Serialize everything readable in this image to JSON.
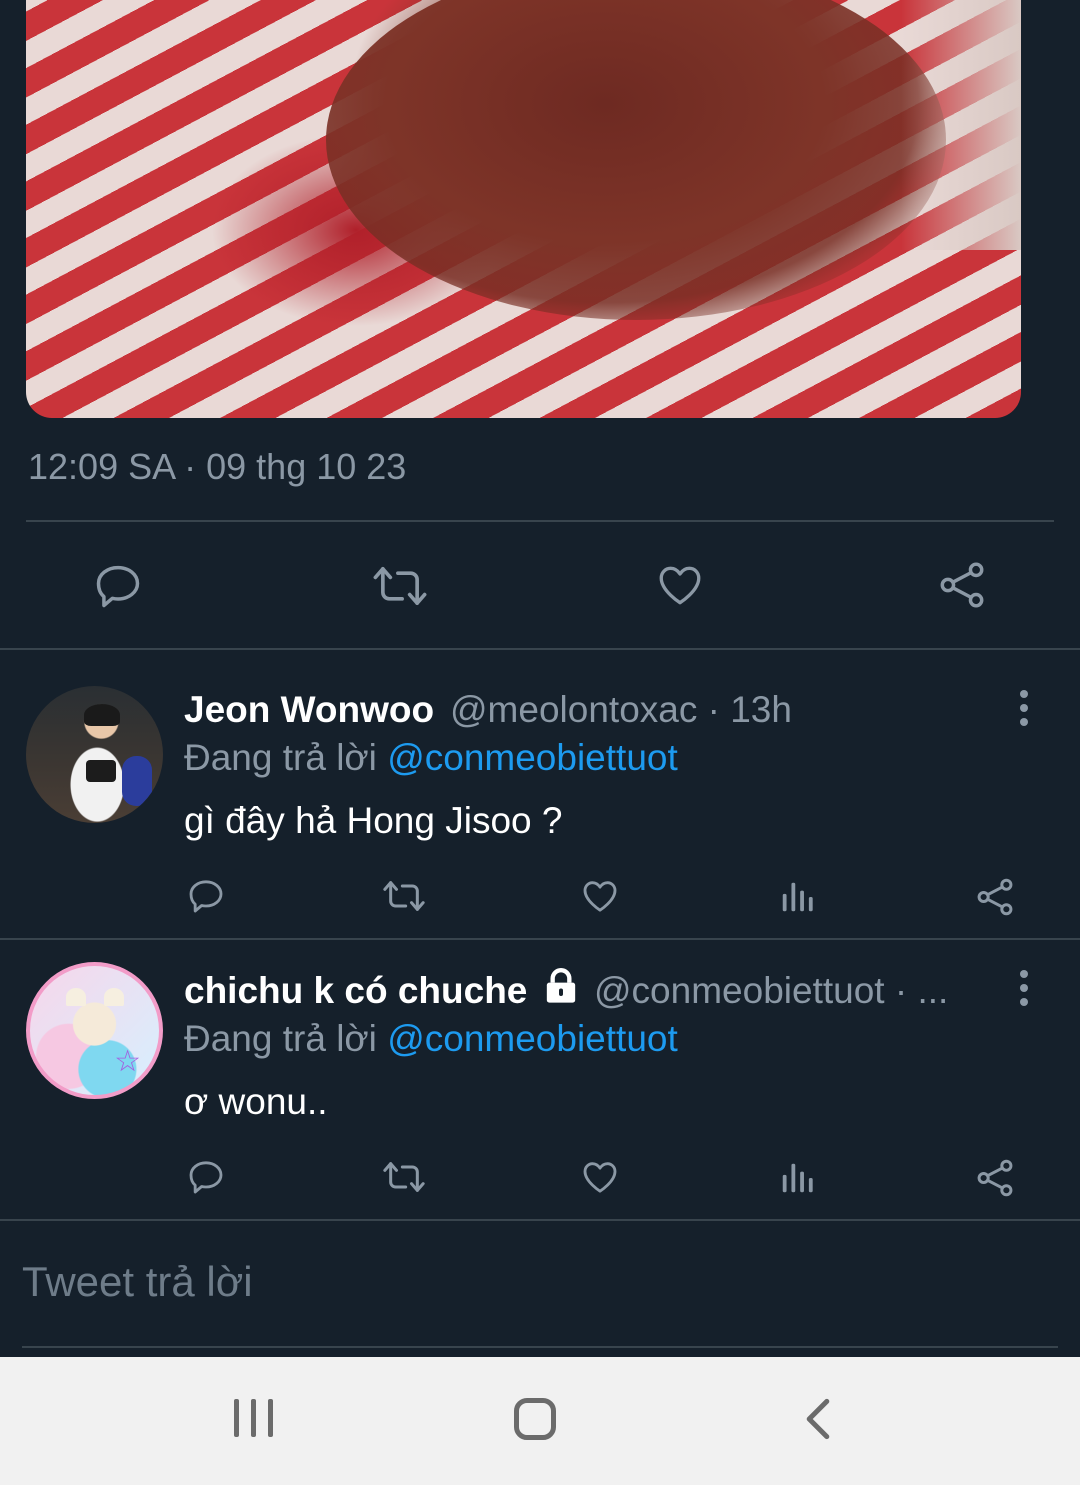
{
  "tweet": {
    "timestamp": "12:09 SA · 09 thg 10 23"
  },
  "main_actions": {
    "reply_icon": "reply-icon",
    "retweet_icon": "retweet-icon",
    "like_icon": "like-icon",
    "share_icon": "share-icon"
  },
  "replies": [
    {
      "name": "Jeon Wonwoo",
      "handle": "@meolontoxac · 13h",
      "replying_prefix": "Đang trả lời",
      "replying_to": "@conmeobiettuot",
      "text": "gì đây hả Hong Jisoo ?"
    },
    {
      "name": "chichu k có chuche",
      "locked": true,
      "handle": "@conmeobiettuot · ...",
      "replying_prefix": "Đang trả lời",
      "replying_to": "@conmeobiettuot",
      "text": "ơ wonu.."
    }
  ],
  "compose": {
    "placeholder": "Tweet trả lời"
  },
  "colors": {
    "background": "#15202b",
    "accent": "#1d9bf0",
    "muted": "#8b98a5",
    "divider": "#38444d"
  }
}
